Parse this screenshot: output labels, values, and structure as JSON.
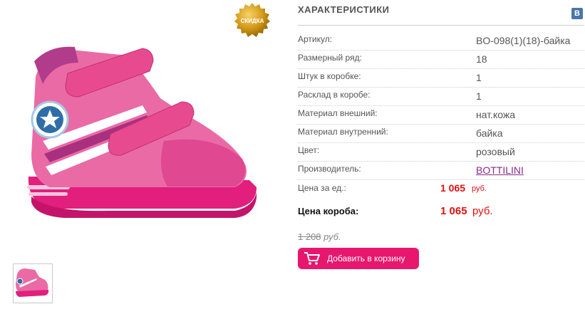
{
  "badge": {
    "label": "СКИДКА"
  },
  "specs": {
    "title": "ХАРАКТЕРИСТИКИ",
    "share_label": "В",
    "rows": [
      {
        "label": "Артикул:",
        "value": "BO-098(1)(18)-байка"
      },
      {
        "label": "Размерный ряд:",
        "value": "18"
      },
      {
        "label": "Штук в коробке:",
        "value": "1"
      },
      {
        "label": "Расклад в коробе:",
        "value": "1"
      },
      {
        "label": "Материал внешний:",
        "value": "нат.кожа"
      },
      {
        "label": "Материал внутренний:",
        "value": "байка"
      },
      {
        "label": "Цвет:",
        "value": "розовый"
      },
      {
        "label": "Производитель:",
        "value": "BOTTILINI"
      }
    ]
  },
  "pricing": {
    "unit_label": "Цена за ед.:",
    "unit_price": "1 065",
    "unit_currency": "руб.",
    "box_label": "Цена короба:",
    "box_price": "1 065",
    "box_currency": "руб.",
    "old_price": "1 208",
    "old_currency": "руб."
  },
  "actions": {
    "add_to_cart": "Добавить в корзину"
  },
  "colors": {
    "accent": "#e8176e",
    "price": "#e01010",
    "link": "#8a2a88",
    "shoe": "#e8559a"
  }
}
